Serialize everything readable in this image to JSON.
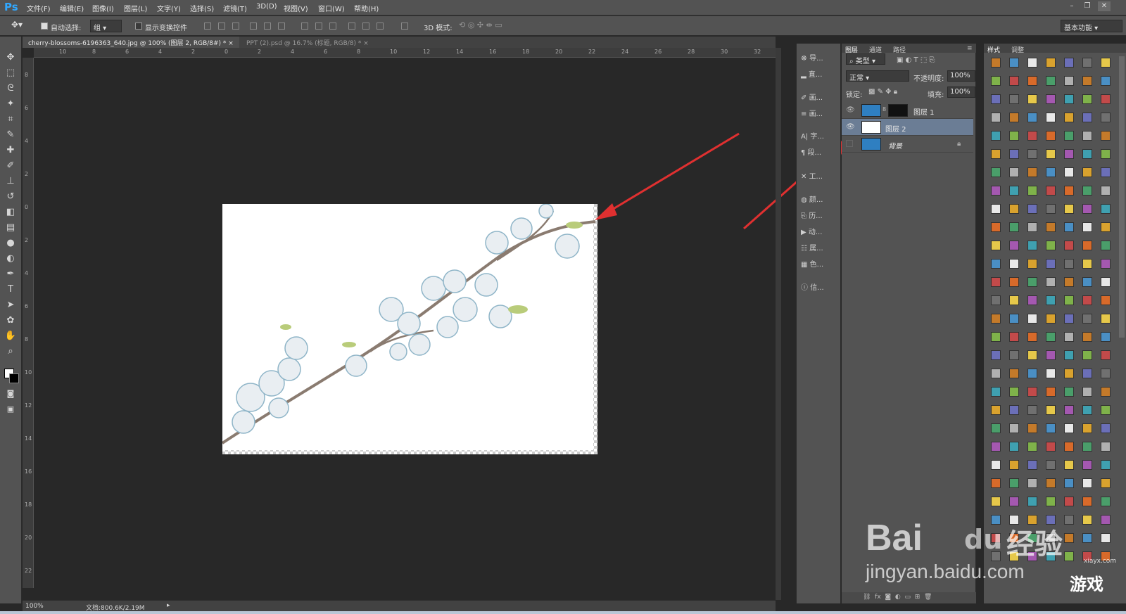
{
  "app": {
    "logo": "Ps"
  },
  "menu": [
    "文件(F)",
    "编辑(E)",
    "图像(I)",
    "图层(L)",
    "文字(Y)",
    "选择(S)",
    "滤镜(T)",
    "3D(D)",
    "视图(V)",
    "窗口(W)",
    "帮助(H)"
  ],
  "options_bar": {
    "auto_select_label": "自动选择:",
    "auto_select_value": "组",
    "show_transform_label": "显示变换控件",
    "mode_3d_label": "3D 模式:",
    "workspace": "基本功能"
  },
  "document_tabs": [
    {
      "label": "cherry-blossoms-6196363_640.jpg @ 100% (图层 2, RGB/8#) *",
      "active": true
    },
    {
      "label": "PPT (2).psd @ 16.7% (标题, RGB/8) *",
      "active": false
    }
  ],
  "ruler_h": [
    "10",
    "8",
    "6",
    "4",
    "2",
    "0",
    "2",
    "4",
    "6",
    "8",
    "10",
    "12",
    "14",
    "16",
    "18",
    "20",
    "22",
    "24",
    "26",
    "28",
    "30",
    "32"
  ],
  "ruler_v": [
    "8",
    "6",
    "4",
    "2",
    "0",
    "2",
    "4",
    "6",
    "8",
    "10",
    "12",
    "14",
    "16",
    "18",
    "20",
    "22"
  ],
  "status": {
    "zoom": "100%",
    "doc_info": "文档:800.6K/2.19M"
  },
  "panel_strip": [
    {
      "icon": "navigator-icon",
      "label": "导..."
    },
    {
      "icon": "histogram-icon",
      "label": "直..."
    },
    {
      "icon": "brush-icon",
      "label": "画..."
    },
    {
      "icon": "brush-preset-icon",
      "label": "画..."
    },
    {
      "icon": "character-icon",
      "label": "字..."
    },
    {
      "icon": "paragraph-icon",
      "label": "段..."
    },
    {
      "icon": "tools-preset-icon",
      "label": "工..."
    },
    {
      "icon": "color-icon",
      "label": "颜..."
    },
    {
      "icon": "history-icon",
      "label": "历..."
    },
    {
      "icon": "actions-icon",
      "label": "动..."
    },
    {
      "icon": "properties-icon",
      "label": "属..."
    },
    {
      "icon": "swatches-icon",
      "label": "色..."
    },
    {
      "icon": "info-icon",
      "label": "信..."
    }
  ],
  "layers_panel": {
    "tabs": [
      "图层",
      "通道",
      "路径"
    ],
    "filter": "类型",
    "blend_mode": "正常",
    "opacity_label": "不透明度:",
    "opacity": "100%",
    "lock_label": "锁定:",
    "fill_label": "填充:",
    "fill": "100%",
    "layers": [
      {
        "name": "图层 1",
        "visible": true,
        "selected": false,
        "has_mask": true
      },
      {
        "name": "图层 2",
        "visible": true,
        "selected": true,
        "has_mask": false
      },
      {
        "name": "背景",
        "visible": false,
        "selected": false,
        "has_mask": false,
        "locked": true
      }
    ],
    "footer_icons": [
      "link-icon",
      "fx-icon",
      "mask-icon",
      "adjustment-icon",
      "folder-icon",
      "new-layer-icon",
      "trash-icon"
    ]
  },
  "styles_panel": {
    "tabs": [
      "样式",
      "调整"
    ]
  },
  "watermark": {
    "brand": "Bai",
    "brand2": "du",
    "brand3": "经验",
    "url": "jingyan.baidu.com",
    "game": "游戏",
    "site": "xiayx.com"
  },
  "colors": {
    "bg": "#282828",
    "panel": "#535353",
    "accent": "#4a6fa5",
    "arrow": "#e03030"
  }
}
